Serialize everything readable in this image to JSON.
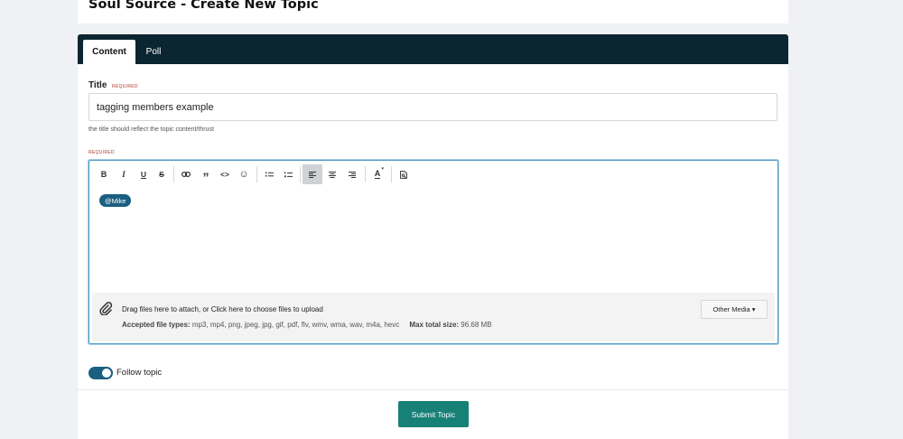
{
  "page": {
    "title": "Soul Source - Create New Topic"
  },
  "tabs": [
    {
      "label": "Content"
    },
    {
      "label": "Poll"
    }
  ],
  "form": {
    "title_label": "Title",
    "required_text": "REQUIRED",
    "title_value": "tagging members example",
    "title_hint": "the title should reflect the topic content/thrust",
    "body_required_text": "REQUIRED"
  },
  "editor": {
    "toolbar": [
      {
        "name": "bold",
        "glyph": "B",
        "icon": "bold-icon"
      },
      {
        "name": "italic",
        "glyph": "I",
        "icon": "italic-icon"
      },
      {
        "name": "underline",
        "glyph": "U",
        "icon": "underline-icon"
      },
      {
        "name": "strikethrough",
        "glyph": "S",
        "icon": "strikethrough-icon"
      },
      {
        "name": "link",
        "glyph": "",
        "icon": "link-icon"
      },
      {
        "name": "quote",
        "glyph": "”",
        "icon": "quote-icon"
      },
      {
        "name": "code",
        "glyph": "<>",
        "icon": "code-icon"
      },
      {
        "name": "emoji",
        "glyph": "☺",
        "icon": "emoji-icon"
      },
      {
        "name": "bullet-list",
        "glyph": "",
        "icon": "bullet-list-icon"
      },
      {
        "name": "numbered-list",
        "glyph": "",
        "icon": "numbered-list-icon"
      },
      {
        "name": "align-left",
        "glyph": "",
        "icon": "align-left-icon",
        "active": true
      },
      {
        "name": "align-center",
        "glyph": "",
        "icon": "align-center-icon"
      },
      {
        "name": "align-right",
        "glyph": "",
        "icon": "align-right-icon"
      },
      {
        "name": "text-color",
        "glyph": "A",
        "icon": "text-color-icon"
      },
      {
        "name": "preview",
        "glyph": "",
        "icon": "preview-icon"
      }
    ],
    "mention": "@Mike",
    "upload": {
      "drag_text": "Drag files here to attach, or ",
      "link_text": "Click here to choose files to upload",
      "accepted_label": "Accepted file types:",
      "accepted_types": "mp3, mp4, png, jpeg, jpg, gif, pdf, flv, wmv, wma, wav, m4a, hevc",
      "max_label": "Max total size:",
      "max_value": "96.68 MB",
      "other_media": "Other Media ▾"
    }
  },
  "follow": {
    "label": "Follow topic",
    "on": true
  },
  "submit": {
    "label": "Submit Topic"
  },
  "colors": {
    "tabbar": "#0b2630",
    "accent": "#1b5f80",
    "submit": "#178077",
    "required": "#b03a2e"
  }
}
